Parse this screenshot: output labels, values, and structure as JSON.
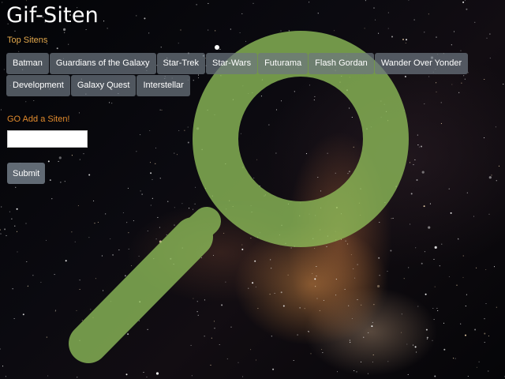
{
  "header": {
    "title": "Gif-Siten"
  },
  "nav": {
    "label": "Top Sitens",
    "tabs": [
      {
        "label": "Batman"
      },
      {
        "label": "Guardians of the Galaxy"
      },
      {
        "label": "Star-Trek"
      },
      {
        "label": "Star-Wars"
      },
      {
        "label": "Futurama"
      },
      {
        "label": "Flash Gordan"
      },
      {
        "label": "Wander Over Yonder"
      },
      {
        "label": "Development"
      },
      {
        "label": "Galaxy Quest"
      },
      {
        "label": "Interstellar"
      }
    ]
  },
  "add_form": {
    "label": "GO Add a Siten!",
    "input_value": "",
    "submit_label": "Submit"
  },
  "overlay": {
    "icon": "search-icon",
    "color": "#8fbf5a"
  }
}
